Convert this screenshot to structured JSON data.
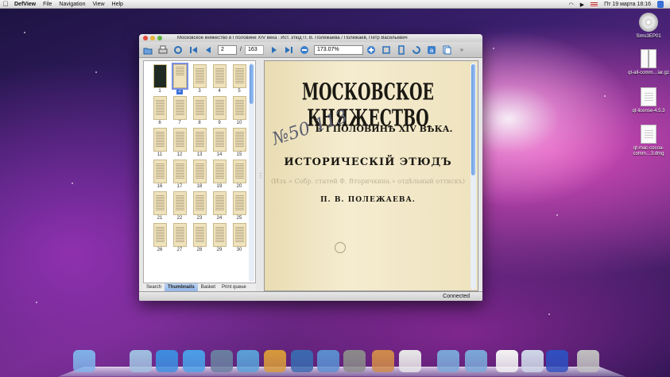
{
  "menubar": {
    "app_name": "DefView",
    "items": [
      "File",
      "Navigation",
      "View",
      "Help"
    ],
    "datetime": "Пт 19 марта  18:16"
  },
  "desktop_icons": [
    {
      "label": "Sims3EP01",
      "icon": "disc-icon"
    },
    {
      "label": "qt-all-comm…iar.gz",
      "icon": "archive-icon"
    },
    {
      "label": "qt-license-4.5.3",
      "icon": "document-icon"
    },
    {
      "label": "qt-mac-cocoa-comm…3.dmg",
      "icon": "disk-image-icon"
    }
  ],
  "window": {
    "title": "Московское княжество в I половине XIV века : Ист. этюд П. В. Полежаева / Полежаев, Петр Васильевич",
    "toolbar": {
      "page_current": "2",
      "page_total": "163",
      "zoom": "173.07%"
    },
    "thumbnails": {
      "selected": 2,
      "pages": [
        "1",
        "2",
        "3",
        "4",
        "5",
        "6",
        "7",
        "8",
        "9",
        "10",
        "11",
        "12",
        "13",
        "14",
        "15",
        "16",
        "17",
        "18",
        "19",
        "20",
        "21",
        "22",
        "23",
        "24",
        "25",
        "26",
        "27",
        "28",
        "29",
        "30"
      ]
    },
    "tabs": [
      "Search",
      "Thumbnails",
      "Basket",
      "Print queue"
    ],
    "active_tab": "Thumbnails",
    "document": {
      "line1": "МОСКОВСКОЕ КНЯЖЕСТВО",
      "line2": "В I ПОЛОВИНѢ XIV ВѢКА.",
      "line3": "ИСТОРИЧЕСКІЙ ЭТЮДЪ",
      "line4": "П. В. ПОЛЕЖАЕВА.",
      "handwriting": "№50 113"
    },
    "status": "Connected"
  },
  "dock": {
    "items": [
      "finder-icon",
      "terminal-icon",
      "preview-icon",
      "safari-icon",
      "itunes-icon",
      "xcode-icon",
      "dashboard-icon",
      "app-icon",
      "instruments-icon",
      "interface-builder-icon",
      "system-preferences-icon",
      "photos-icon",
      "script-editor-icon",
      "applications-folder-icon",
      "documents-folder-icon",
      "document-icon",
      "stack-icon",
      "screen-icon",
      "trash-icon"
    ]
  }
}
